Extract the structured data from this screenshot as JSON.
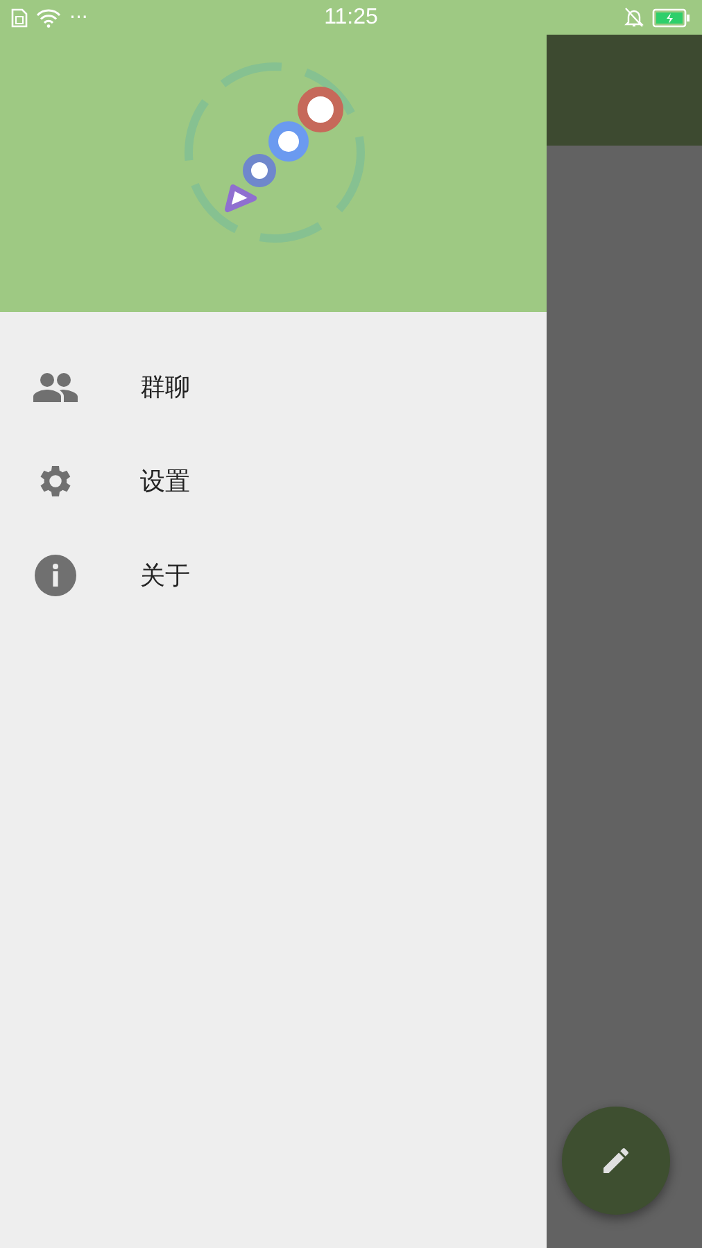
{
  "status_bar": {
    "time": "11:25",
    "indicators": "···"
  },
  "drawer": {
    "items": [
      {
        "kind": "group",
        "label": "群聊"
      },
      {
        "kind": "settings",
        "label": "设置"
      },
      {
        "kind": "info",
        "label": "关于"
      }
    ]
  }
}
